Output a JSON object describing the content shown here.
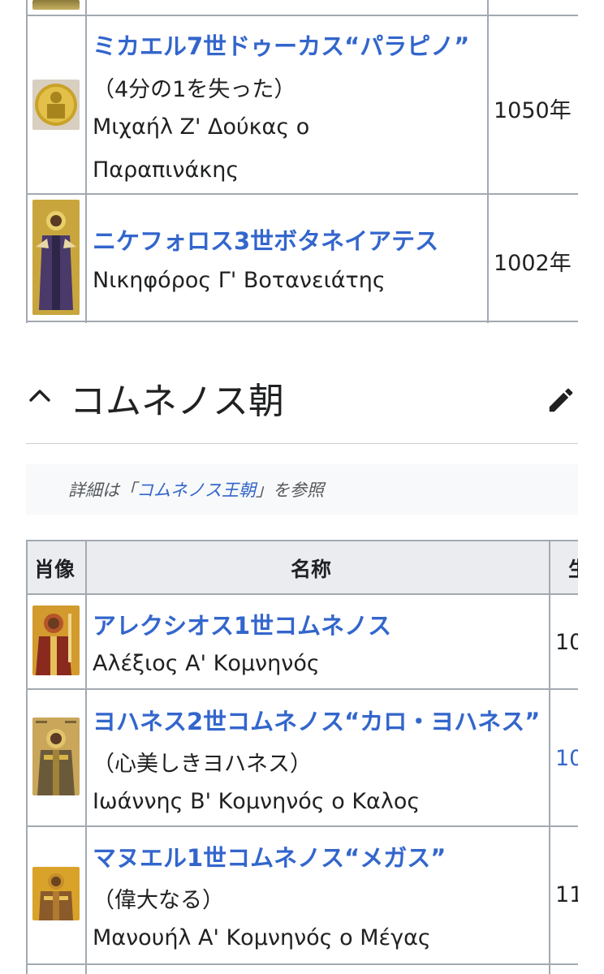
{
  "table1": {
    "rows": [
      {
        "name_link": "ミカエル7世ドゥーカス“パラピノ”",
        "epithet": "（4分の1を失った）",
        "greek_line1": "Μιχαήλ Ζ' Δούκας ο",
        "greek_line2": "Παραπινάκης",
        "year": "1050年"
      },
      {
        "name_link": "ニケフォロス3世ボタネイアテス",
        "greek": "Νικηφόρος Γ' Βοτανειάτης",
        "year": "1002年"
      }
    ]
  },
  "section": {
    "title": "コムネノス朝",
    "hatnote_prefix": "詳細は「",
    "hatnote_link": "コムネノス王朝",
    "hatnote_suffix": "」を参照"
  },
  "table2": {
    "headers": {
      "portrait": "肖像",
      "name": "名称",
      "partial": "生"
    },
    "rows": [
      {
        "name_link": "アレクシオス1世コムネノス",
        "greek": "Αλέξιος Α' Κομνηνός",
        "year": "10"
      },
      {
        "name_link": "ヨハネス2世コムネノス“カロ・ヨハネス”",
        "epithet": "（心美しきヨハネス）",
        "greek": "Ιωάννης Β' Κομνηνός ο Καλος",
        "year": "10"
      },
      {
        "name_link": "マヌエル1世コムネノス“メガス”",
        "epithet": "（偉大なる）",
        "greek": "Μανουήλ Α' Κομνηνός ο Μέγας",
        "year": "11"
      }
    ]
  },
  "icons": [
    "chevron-up-icon",
    "edit-pencil-icon"
  ],
  "colors": {
    "link": "#3366cc",
    "text": "#202122",
    "border": "#a2a9b1",
    "header_bg": "#eaecf0",
    "hatnote_bg": "#f8f9fa"
  }
}
